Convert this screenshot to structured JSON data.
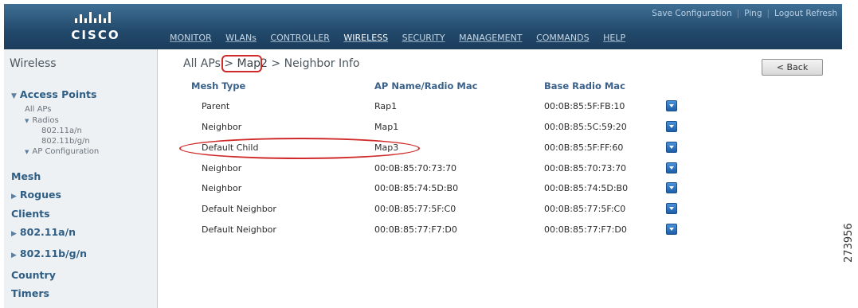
{
  "header": {
    "logo_text": "CISCO",
    "links": [
      "Save Configuration",
      "Ping",
      "Logout",
      "Refresh"
    ],
    "nav": [
      "MONITOR",
      "WLANs",
      "CONTROLLER",
      "WIRELESS",
      "SECURITY",
      "MANAGEMENT",
      "COMMANDS",
      "HELP"
    ],
    "active_nav": "WIRELESS"
  },
  "sidebar": {
    "title": "Wireless",
    "access_points": "Access Points",
    "all_aps": "All APs",
    "radios": "Radios",
    "radio_a": "802.11a/n",
    "radio_bg": "802.11b/g/n",
    "ap_config": "AP Configuration",
    "mesh": "Mesh",
    "rogues": "Rogues",
    "clients": "Clients",
    "dot11an": "802.11a/n",
    "dot11bgn": "802.11b/g/n",
    "country": "Country",
    "timers": "Timers"
  },
  "breadcrumb": {
    "part1": "All APs > ",
    "part2": "Map2",
    "part3": " > Neighbor Info"
  },
  "back_label": "< Back",
  "table": {
    "headers": [
      "Mesh Type",
      "AP Name/Radio Mac",
      "Base Radio Mac"
    ],
    "rows": [
      {
        "type": "Parent",
        "name": "Rap1",
        "mac": "00:0B:85:5F:FB:10"
      },
      {
        "type": "Neighbor",
        "name": "Map1",
        "mac": "00:0B:85:5C:59:20"
      },
      {
        "type": "Default Child",
        "name": "Map3",
        "mac": "00:0B:85:5F:FF:60"
      },
      {
        "type": "Neighbor",
        "name": "00:0B:85:70:73:70",
        "mac": "00:0B:85:70:73:70"
      },
      {
        "type": "Neighbor",
        "name": "00:0B:85:74:5D:B0",
        "mac": "00:0B:85:74:5D:B0"
      },
      {
        "type": "Default Neighbor",
        "name": "00:0B:85:77:5F:C0",
        "mac": "00:0B:85:77:5F:C0"
      },
      {
        "type": "Default Neighbor",
        "name": "00:0B:85:77:F7:D0",
        "mac": "00:0B:85:77:F7:D0"
      }
    ]
  },
  "figure_number": "273956",
  "colors": {
    "header_bg": "#22496b",
    "highlight": "#d02a2a",
    "link": "#2f5e85"
  }
}
